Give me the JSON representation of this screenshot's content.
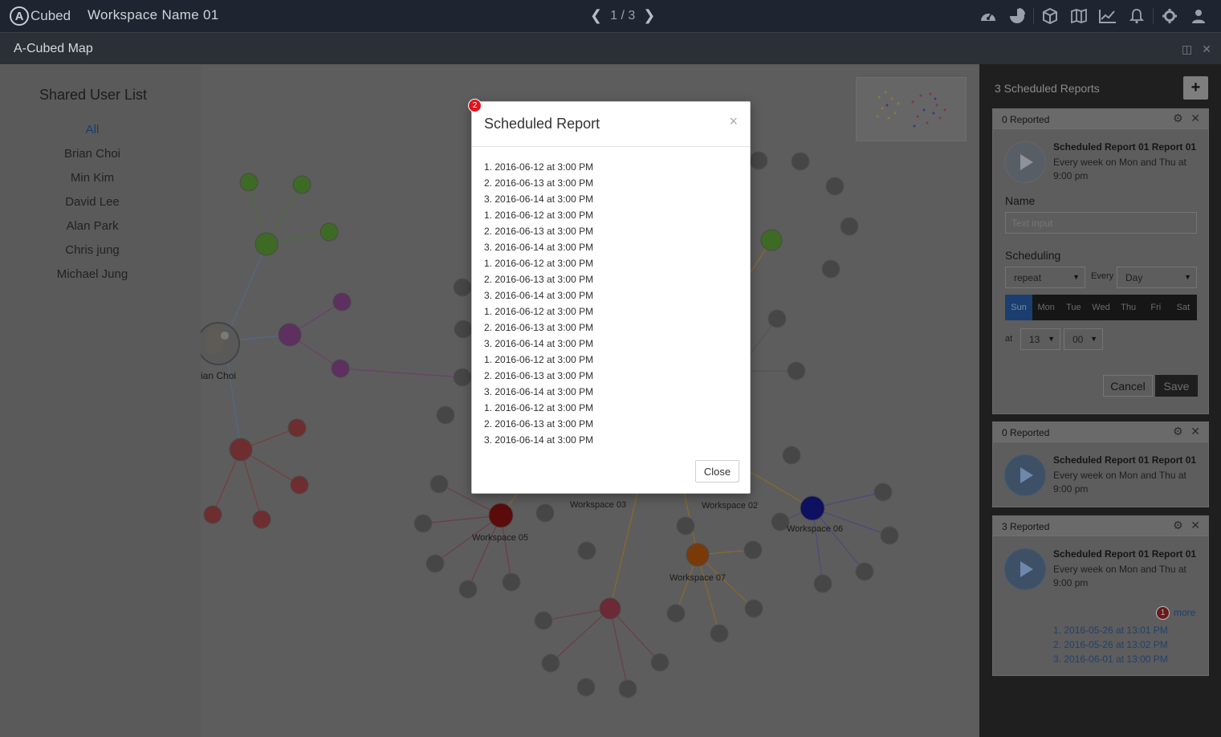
{
  "topbar": {
    "logo_letter": "A",
    "logo_text": "Cubed",
    "workspace_name": "Workspace Name 01",
    "pager": "1 / 3",
    "icons": [
      "dashboard-icon",
      "pie-chart-icon",
      "cube-icon",
      "map-icon",
      "line-chart-icon",
      "bell-icon",
      "gear-icon",
      "user-icon"
    ]
  },
  "subbar": {
    "title": "A-Cubed Map"
  },
  "userlist": {
    "title": "Shared User List",
    "items": [
      "All",
      "Brian Choi",
      "Min Kim",
      "David Lee",
      "Alan Park",
      "Chris jung",
      "Michael Jung"
    ]
  },
  "map": {
    "user_label": "ian Choi",
    "workspaces": [
      "Workspace 02",
      "Workspace 03",
      "Workspace 05",
      "Workspace 06",
      "Workspace 07"
    ]
  },
  "panel": {
    "heading": "3 Scheduled Reports",
    "add_label": "+",
    "cards": [
      {
        "status": "0 Reported",
        "title": "Scheduled Report 01 Report 01",
        "desc": "Every week on Mon and Thu at 9:00 pm",
        "form": {
          "name_label": "Name",
          "name_placeholder": "Text input",
          "scheduling_label": "Scheduling",
          "repeat_value": "repeat",
          "every_label": "Every",
          "every_value": "Day",
          "days": [
            "Sun",
            "Mon",
            "Tue",
            "Wed",
            "Thu",
            "Fri",
            "Sat"
          ],
          "selected_day": "Sun",
          "at_label": "at",
          "hour": "13",
          "minute": "00",
          "cancel": "Cancel",
          "save": "Save"
        }
      },
      {
        "status": "0 Reported",
        "title": "Scheduled Report 01 Report 01",
        "desc": "Every week on Mon and Thu at 9:00 pm"
      },
      {
        "status": "3 Reported",
        "title": "Scheduled Report 01 Report 01",
        "desc": "Every week on Mon and Thu at 9:00 pm",
        "more": "more",
        "badge": "1",
        "history": [
          "1. 2016-05-26 at 13:01 PM",
          "2. 2016-05-26 at 13:02 PM",
          "3. 2016-06-01 at 13:00 PM"
        ]
      }
    ]
  },
  "modal": {
    "badge": "2",
    "title": "Scheduled Report",
    "close_x": "×",
    "items": [
      "1. 2016-06-12 at 3:00 PM",
      "2. 2016-06-13 at 3:00 PM",
      "3. 2016-06-14 at 3:00 PM",
      "1. 2016-06-12 at 3:00 PM",
      "2. 2016-06-13 at 3:00 PM",
      "3. 2016-06-14 at 3:00 PM",
      "1. 2016-06-12 at 3:00 PM",
      "2. 2016-06-13 at 3:00 PM",
      "3. 2016-06-14 at 3:00 PM",
      "1. 2016-06-12 at 3:00 PM",
      "2. 2016-06-13 at 3:00 PM",
      "3. 2016-06-14 at 3:00 PM",
      "1. 2016-06-12 at 3:00 PM",
      "2. 2016-06-13 at 3:00 PM",
      "3. 2016-06-14 at 3:00 PM",
      "1. 2016-06-12 at 3:00 PM",
      "2. 2016-06-13 at 3:00 PM",
      "3. 2016-06-14 at 3:00 PM"
    ],
    "close_button": "Close"
  }
}
